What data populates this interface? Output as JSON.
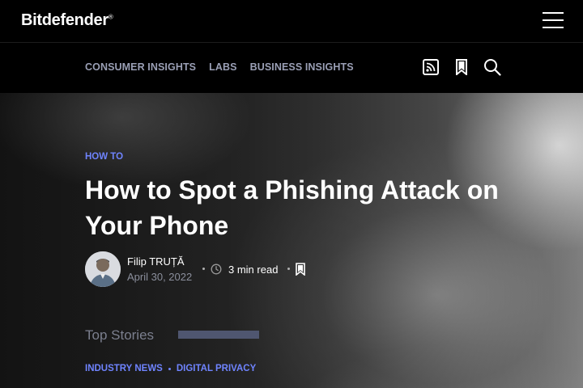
{
  "header": {
    "logo_text": "Bitdefender",
    "logo_mark": "®",
    "menu_icon": "hamburger-menu-icon"
  },
  "nav": {
    "links": [
      "CONSUMER INSIGHTS",
      "LABS",
      "BUSINESS INSIGHTS"
    ],
    "icons": [
      "rss-icon",
      "bookmark-icon",
      "search-icon"
    ]
  },
  "article": {
    "category": "HOW TO",
    "title": "How to Spot a Phishing Attack on Your Phone",
    "author": "Filip TRUȚĂ",
    "date": "April 30, 2022",
    "read_time": "3 min read"
  },
  "top_stories": {
    "heading": "Top Stories",
    "tags": [
      "INDUSTRY NEWS",
      "DIGITAL PRIVACY"
    ]
  },
  "colors": {
    "accent": "#6f84ff",
    "nav_text": "#9a9fb5",
    "background": "#000000"
  }
}
